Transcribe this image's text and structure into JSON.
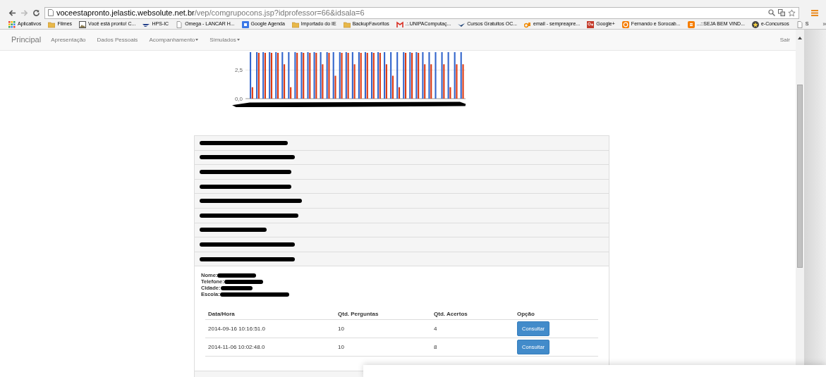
{
  "browser": {
    "address": {
      "host": "voceestapronto.jelastic.websolute.net.br",
      "path": "/vep/comgrupocons.jsp?idprofessor=66&idsala=6"
    },
    "bookmarks": [
      {
        "label": "Aplicativos",
        "kind": "apps"
      },
      {
        "label": "Filmes",
        "kind": "folder"
      },
      {
        "label": "Você está pronto! C...",
        "kind": "image"
      },
      {
        "label": "HPS-IC",
        "kind": "wing"
      },
      {
        "label": "Omega - LANCAR H...",
        "kind": "page"
      },
      {
        "label": "Google Agenda",
        "kind": "calendar"
      },
      {
        "label": "Importado do IE",
        "kind": "folder"
      },
      {
        "label": "BackupFavoritos",
        "kind": "folder"
      },
      {
        "label": ".:.UNIPAComputaç...",
        "kind": "mail"
      },
      {
        "label": "Cursos Gratuitos OC...",
        "kind": "bird"
      },
      {
        "label": "email - sempreapre...",
        "kind": "tag"
      },
      {
        "label": "Google+",
        "kind": "gplus"
      },
      {
        "label": "Fernando e Sorocab...",
        "kind": "ring"
      },
      {
        "label": "...::SEJA BEM VIND...",
        "kind": "blog"
      },
      {
        "label": "e-Concursos",
        "kind": "star"
      },
      {
        "label": "S",
        "kind": "page"
      }
    ],
    "more": "»"
  },
  "navbar": {
    "brand": "Principal",
    "items": [
      {
        "label": "Apresentação",
        "dropdown": false
      },
      {
        "label": "Dados Pessoais",
        "dropdown": false
      },
      {
        "label": "Acompanhamento",
        "dropdown": true
      },
      {
        "label": "Simulados",
        "dropdown": true
      }
    ],
    "logout": "Sair"
  },
  "chart": {
    "chart_data": {
      "type": "bar",
      "ylim": [
        0,
        4.06
      ],
      "yticks": [
        {
          "value": 0,
          "label": "0,0"
        },
        {
          "value": 2.5,
          "label": "2,5"
        }
      ],
      "series": [
        {
          "color": "#3366cc",
          "values": [
            null,
            null,
            null,
            null,
            null,
            null,
            null,
            null,
            null,
            null,
            null,
            null,
            null,
            null,
            null,
            null,
            null,
            null,
            null,
            null,
            null,
            null,
            null,
            null,
            null,
            null,
            null,
            null,
            null,
            null,
            null,
            null,
            null,
            null
          ]
        },
        {
          "color": "#dc3912",
          "values": [
            1,
            4,
            4,
            4,
            4,
            3,
            1,
            4,
            4,
            4,
            4,
            3,
            4,
            2,
            4,
            4,
            3,
            4,
            4,
            4,
            4,
            3,
            2,
            1,
            4,
            4,
            4,
            3,
            3,
            0,
            3,
            1,
            3,
            3
          ]
        }
      ]
    }
  },
  "sections": [
    {
      "kind": "redacted"
    },
    {
      "kind": "redacted"
    },
    {
      "kind": "redacted"
    },
    {
      "kind": "redacted"
    },
    {
      "kind": "redacted"
    },
    {
      "kind": "redacted"
    },
    {
      "kind": "redacted"
    },
    {
      "kind": "redacted"
    },
    {
      "kind": "redacted"
    }
  ],
  "student": [
    {
      "label": "Nome:",
      "kind": "redacted"
    },
    {
      "label": "Telefone:",
      "kind": "redacted"
    },
    {
      "label": "Cidade:",
      "kind": "redacted"
    },
    {
      "label": "Escola:",
      "kind": "redacted"
    }
  ],
  "table": {
    "columns": [
      "Data/Hora",
      "Qtd. Perguntas",
      "Qtd. Acertos",
      "Opção"
    ],
    "rows": [
      {
        "date": "2014-09-16 10:16:51.0",
        "questions": "10",
        "correct": "4",
        "action": "Consultar"
      },
      {
        "date": "2014-11-06 10:02:48.0",
        "questions": "10",
        "correct": "8",
        "action": "Consultar"
      }
    ]
  }
}
